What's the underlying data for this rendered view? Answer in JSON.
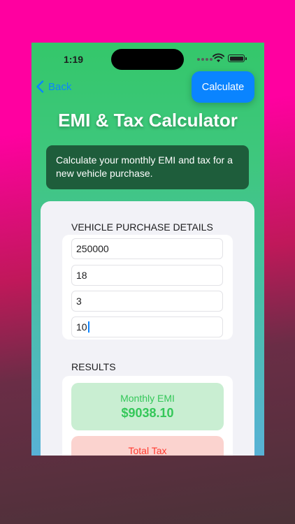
{
  "status_bar": {
    "time": "1:19"
  },
  "nav": {
    "back_label": "Back",
    "calculate_label": "Calculate"
  },
  "page_title": "EMI & Tax Calculator",
  "description": "Calculate your monthly EMI and tax for a new vehicle purchase.",
  "form": {
    "section_title": "VEHICLE PURCHASE DETAILS",
    "fields": [
      "250000",
      "18",
      "3",
      "10"
    ]
  },
  "results": {
    "section_title": "RESULTS",
    "emi_label": "Monthly EMI",
    "emi_value": "$9038.10",
    "tax_label": "Total Tax"
  },
  "colors": {
    "accent": "#0a84ff",
    "emi_green": "#34c759",
    "tax_red": "#ff3b30",
    "info_card_bg": "#1e5d3b"
  },
  "icons": [
    "chevron-left-icon",
    "wifi-icon",
    "battery-icon",
    "cellular-signal-icon"
  ]
}
